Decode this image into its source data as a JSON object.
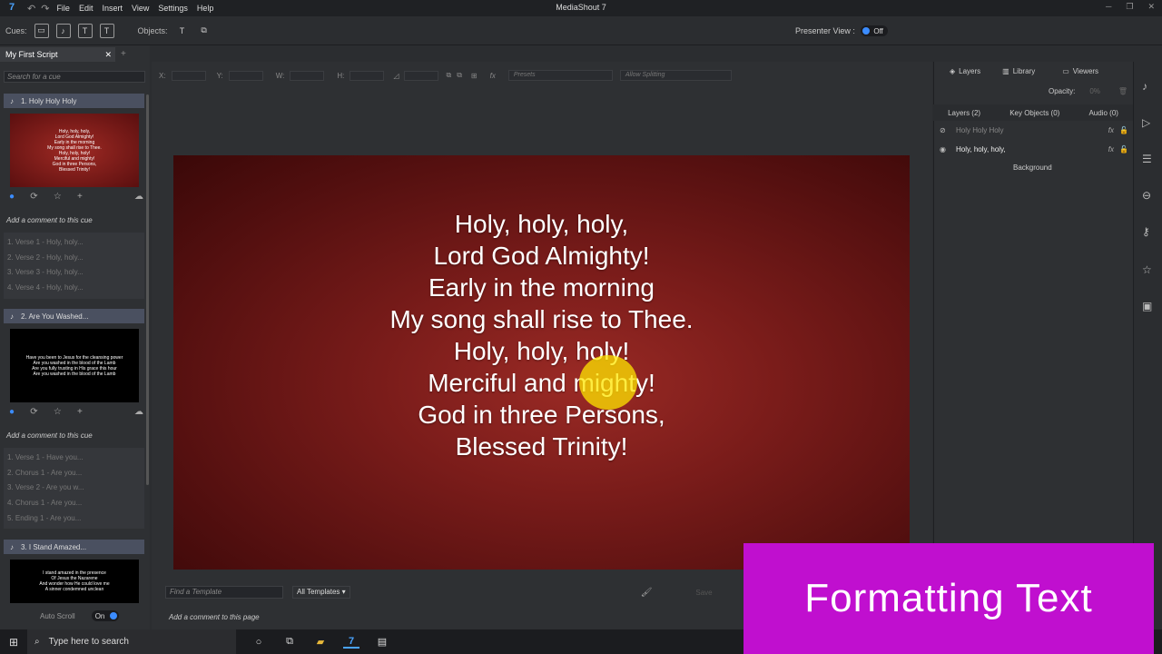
{
  "app": {
    "title": "MediaShout 7",
    "icon_label": "7",
    "menu": [
      "File",
      "Edit",
      "Insert",
      "View",
      "Settings",
      "Help"
    ]
  },
  "toolbar": {
    "cues_label": "Cues:",
    "objects_label": "Objects:",
    "presenter_view_label": "Presenter View :",
    "presenter_toggle": "Off"
  },
  "script": {
    "tab_label": "My First Script",
    "search_placeholder": "Search for a cue",
    "cues": [
      {
        "header": "1.  Holy Holy Holy",
        "thumb_lines": [
          "Holy, holy, holy,",
          "Lord God Almighty!",
          "Early in the morning",
          "My song shall rise to Thee.",
          "Holy, holy, holy!",
          "Merciful and mighty!",
          "God in three Persons,",
          "Blessed Trinity!"
        ],
        "thumb_color": "#8a1e1e",
        "comment": "Add a comment to this cue",
        "items": [
          "1.  Verse 1 - Holy, holy...",
          "2.  Verse 2 - Holy, holy...",
          "3.  Verse 3 - Holy, holy...",
          "4.  Verse 4 - Holy, holy..."
        ]
      },
      {
        "header": "2.  Are You Washed...",
        "thumb_lines": [
          "Have you been to Jesus for the cleansing power",
          "Are you washed in the blood of the Lamb",
          "Are you fully trusting in His grace this hour",
          "Are you washed in the blood of the Lamb"
        ],
        "thumb_color": "#000000",
        "comment": "Add a comment to this cue",
        "items": [
          "1.  Verse 1 - Have you...",
          "2.  Chorus 1 - Are you...",
          "3.  Verse 2 - Are you w...",
          "4.  Chorus 1 - Are you...",
          "5.  Ending 1 - Are you..."
        ]
      },
      {
        "header": "3.  I Stand Amazed...",
        "thumb_lines": [
          "I stand amazed in the presence",
          "Of Jesus the Nazarene",
          "And wonder how He could love me",
          "A sinner condemned unclean"
        ],
        "thumb_color": "#000000"
      }
    ],
    "auto_scroll_label": "Auto Scroll",
    "auto_scroll_toggle": "On"
  },
  "props": {
    "x_label": "X:",
    "y_label": "Y:",
    "w_label": "W:",
    "h_label": "H:",
    "fx_label": "fx",
    "presets": "Presets",
    "splitting": "Allow Splitting"
  },
  "slide": {
    "lyrics": [
      "Holy, holy, holy,",
      "Lord God Almighty!",
      "Early in the morning",
      "My song shall rise to Thee.",
      "Holy, holy, holy!",
      "Merciful and mighty!",
      "God in three Persons,",
      "Blessed Trinity!"
    ]
  },
  "templates": {
    "find_placeholder": "Find a Template",
    "filter": "All Templates",
    "save_label": "Save",
    "page_comment": "Add a comment to this page"
  },
  "right_panel": {
    "tabs": [
      "Layers",
      "Library",
      "Viewers"
    ],
    "opacity_label": "Opacity:",
    "opacity_value": "0%",
    "sub_tabs": [
      "Layers (2)",
      "Key Objects (0)",
      "Audio (0)"
    ],
    "layers": [
      {
        "name": "Holy Holy Holy",
        "fx": "fx"
      },
      {
        "name": "Holy, holy, holy,",
        "fx": "fx"
      }
    ],
    "background_label": "Background"
  },
  "taskbar": {
    "search_placeholder": "Type here to search"
  },
  "overlay": {
    "text": "Formatting Text"
  },
  "colors": {
    "accent": "#3b8cff",
    "overlay_bg": "#c00fcf",
    "cue_header": "#4a5060",
    "cursor_highlight": "#ffe600"
  }
}
